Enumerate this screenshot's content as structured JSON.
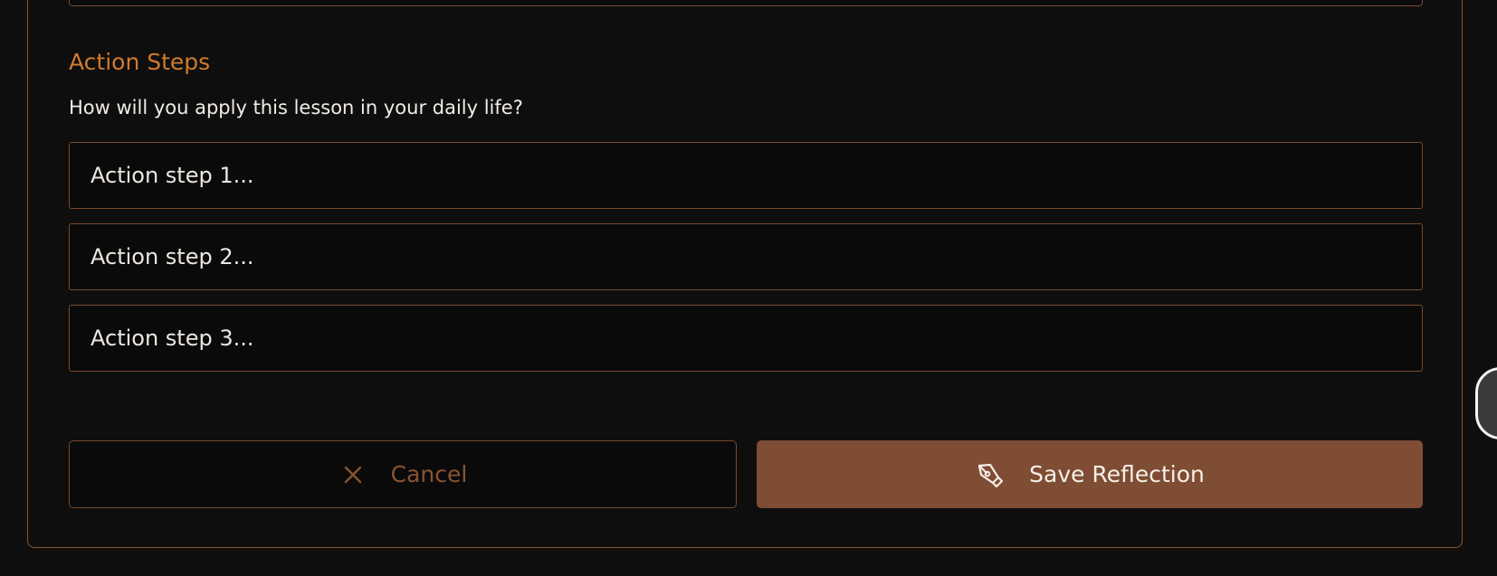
{
  "section": {
    "title": "Action Steps",
    "prompt": "How will you apply this lesson in your daily life?"
  },
  "action_steps": [
    {
      "placeholder": "Action step 1...",
      "value": ""
    },
    {
      "placeholder": "Action step 2...",
      "value": ""
    },
    {
      "placeholder": "Action step 3...",
      "value": ""
    }
  ],
  "buttons": {
    "cancel": {
      "label": "Cancel",
      "icon": "close-icon"
    },
    "save": {
      "label": "Save Reflection",
      "icon": "pen-nib-icon"
    }
  },
  "colors": {
    "accent": "#d07a2e",
    "border": "#7a4a2c",
    "save_button_bg": "#7f4c34",
    "cancel_text": "#8a5332",
    "background": "#0f0f0f"
  }
}
